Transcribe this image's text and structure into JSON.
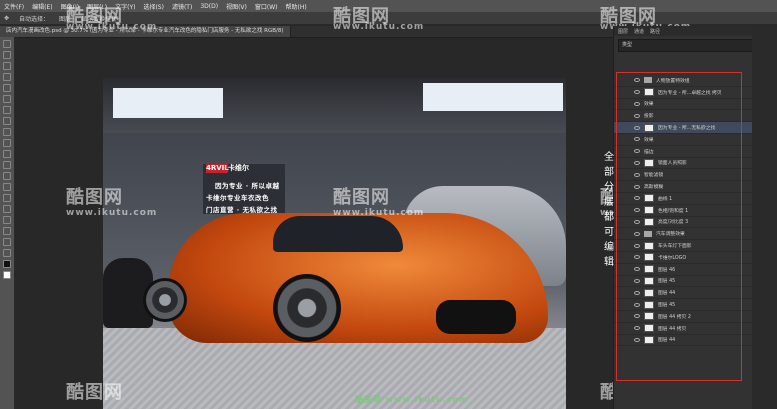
{
  "menubar": {
    "items": [
      "文件(F)",
      "编辑(E)",
      "图像(I)",
      "图层(L)",
      "文字(Y)",
      "选择(S)",
      "滤镜(T)",
      "3D(D)",
      "视图(V)",
      "窗口(W)",
      "帮助(H)"
    ]
  },
  "optionsbar": {
    "auto_select": "自动选择：",
    "layer": "图层",
    "show_transform": "显示变换控件"
  },
  "doctab": {
    "title": "店内汽车漫画改色.psd @ 30.7% (因为专业 - 所以卓 - 卡维尔专业汽车改色的隐私门店服务 - 无私欲之找 RGB/8)"
  },
  "photo": {
    "logo_red": "4RVIL",
    "logo_white": "卡维尔",
    "sign_lines": [
      "因为专业 · 所以卓越",
      "卡维尔专业车衣改色",
      "门店直营 · 无私欲之找"
    ]
  },
  "watermark": {
    "logo": "酷图网",
    "url": "www.ikutu.com",
    "bottom_caption": "酷图网 www.ikutu.com"
  },
  "right_panel": {
    "tabs": [
      "图层",
      "通道",
      "路径"
    ],
    "search_placeholder": "类型",
    "layers": [
      "人物放置特效组",
      "因为专业 - 所...卓越之找 拷贝",
      "效果",
      "投影",
      "因为专业 - 所...无私欲之找",
      "效果",
      "描边",
      "镜面人员照影",
      "智能滤镜",
      "高斯模糊",
      "曲线 1",
      "色相/饱和度 1",
      "亮度/对比度 3",
      "汽车调整效果",
      "车头车灯下面影",
      "卡维尔LOGO",
      "图层 46",
      "图层 45",
      "图层 44",
      "图层 45",
      "图层 44 拷贝 2",
      "图层 44 拷贝",
      "图层 44"
    ],
    "annotation": "全部分层都可编辑"
  }
}
